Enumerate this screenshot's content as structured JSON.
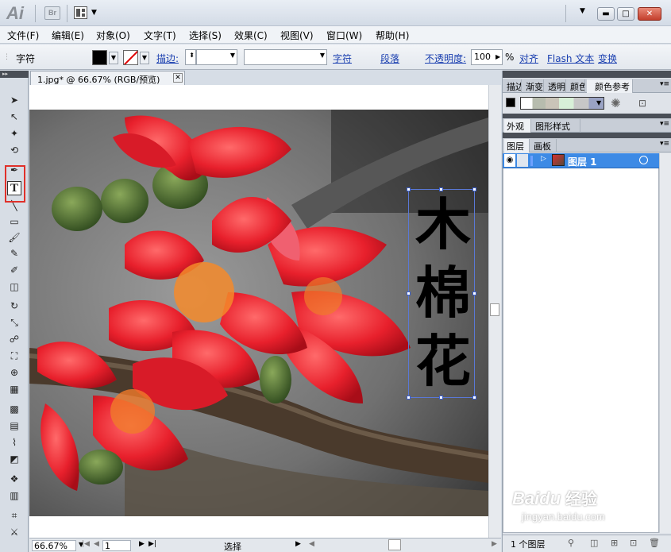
{
  "app": {
    "logo": "Ai",
    "bridge": "Br"
  },
  "menu": [
    "文件(F)",
    "编辑(E)",
    "对象(O)",
    "文字(T)",
    "选择(S)",
    "效果(C)",
    "视图(V)",
    "窗口(W)",
    "帮助(H)"
  ],
  "control_bar": {
    "mode_label": "字符",
    "stroke_label": "描边:",
    "char_link": "字符",
    "para_link": "段落",
    "opacity_label": "不透明度:",
    "opacity_value": "100",
    "opacity_unit": "%",
    "align_link": "对齐",
    "flash_link": "Flash 文本",
    "transform_link": "变换"
  },
  "document": {
    "tab_title": "1.jpg* @ 66.67% (RGB/预览)",
    "close": "✕"
  },
  "artwork_text": [
    "木",
    "棉",
    "花"
  ],
  "status": {
    "zoom": "66.67%",
    "page": "1",
    "tool": "选择"
  },
  "panels": {
    "top_tabs": [
      "描边",
      "渐变",
      "透明",
      "颜色",
      "颜色参考"
    ],
    "mid_tabs": [
      "外观",
      "图形样式"
    ],
    "layer_tabs": [
      "图层",
      "画板"
    ],
    "layer_name": "图层 1",
    "layer_count": "1 个图层"
  },
  "watermark": {
    "brand": "Baidu",
    "brand_cn": "经验",
    "url": "jingyan.baidu.com"
  },
  "colors": {
    "highlight": "#e0302a",
    "layer_selected": "#3d8ae5",
    "link": "#1a3fb0"
  }
}
